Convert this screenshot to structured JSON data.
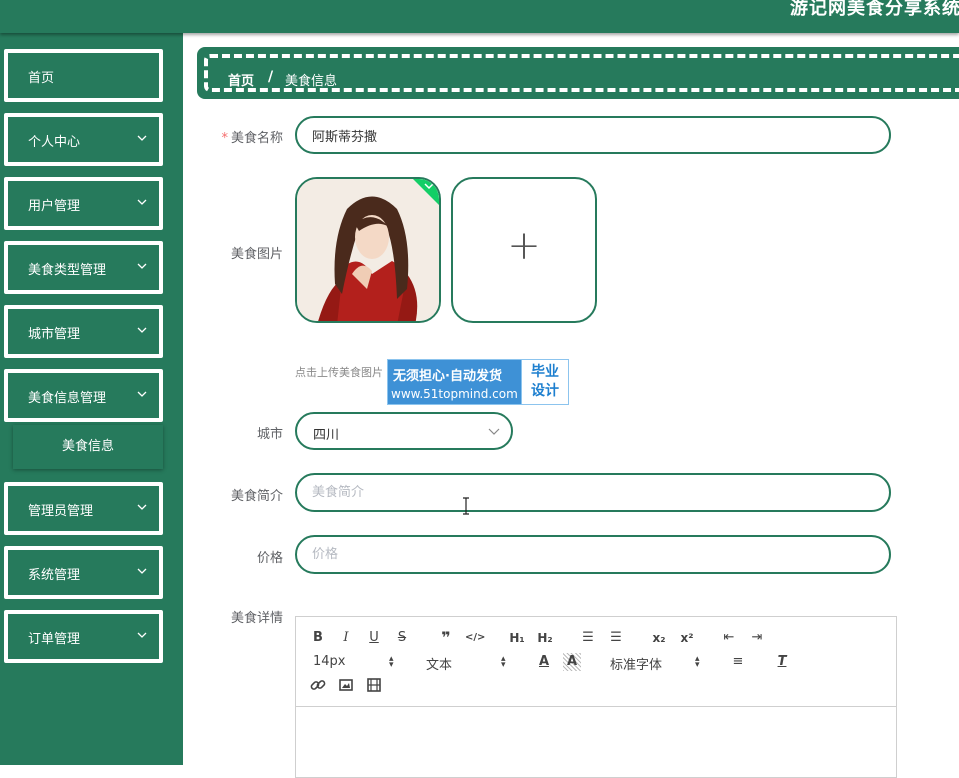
{
  "header": {
    "app_title": "游记网美食分享系统"
  },
  "sidebar": {
    "items": [
      {
        "label": "首页"
      },
      {
        "label": "个人中心"
      },
      {
        "label": "用户管理"
      },
      {
        "label": "美食类型管理"
      },
      {
        "label": "城市管理"
      },
      {
        "label": "美食信息管理"
      },
      {
        "label": "管理员管理"
      },
      {
        "label": "系统管理"
      },
      {
        "label": "订单管理"
      }
    ],
    "sub_item": {
      "label": "美食信息"
    }
  },
  "breadcrumb": {
    "home": "首页",
    "separator": "/",
    "current": "美食信息"
  },
  "form": {
    "required_mark": "*",
    "name": {
      "label": "美食名称",
      "value": "阿斯蒂芬撒"
    },
    "image": {
      "label": "美食图片",
      "tip": "点击上传美食图片",
      "upload_plus": "+"
    },
    "city": {
      "label": "城市",
      "value": "四川"
    },
    "intro": {
      "label": "美食简介",
      "placeholder": "美食简介"
    },
    "price": {
      "label": "价格",
      "placeholder": "价格"
    },
    "detail": {
      "label": "美食详情",
      "toolbar": {
        "font_size": "14px",
        "header_select": "文本",
        "font_family": "标准字体"
      }
    }
  },
  "watermark": {
    "line1": "无须担心·自动发货",
    "line2": "www.51topmind.com",
    "box_line1": "毕业",
    "box_line2": "设计"
  },
  "colors": {
    "primary": "#267a5c",
    "required": "#f56c6c",
    "watermark_blue": "#3e91d6"
  }
}
